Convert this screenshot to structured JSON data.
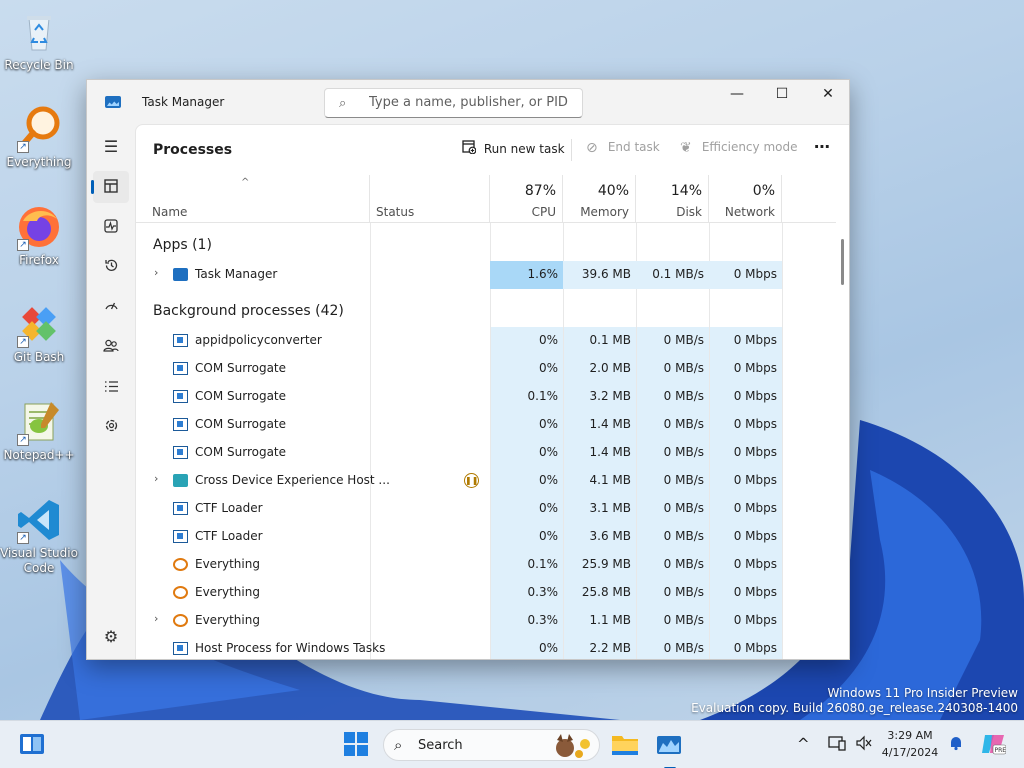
{
  "desktop": {
    "icons": [
      {
        "label": "Recycle Bin",
        "icon": "recycle-bin-icon"
      },
      {
        "label": "Everything",
        "icon": "everything-icon"
      },
      {
        "label": "Firefox",
        "icon": "firefox-icon"
      },
      {
        "label": "Git Bash",
        "icon": "git-bash-icon"
      },
      {
        "label": "Notepad++",
        "icon": "notepad-plus-plus-icon"
      },
      {
        "label": "Visual Studio Code",
        "icon": "vscode-icon"
      }
    ],
    "watermark_line1": "Windows 11 Pro Insider Preview",
    "watermark_line2": "Evaluation copy. Build 26080.ge_release.240308-1400"
  },
  "window": {
    "title": "Task Manager",
    "search_placeholder": "Type a name, publisher, or PID...",
    "controls": {
      "minimize": "—",
      "maximize": "☐",
      "close": "✕"
    }
  },
  "nav": {
    "items": [
      "menu-icon",
      "processes-icon",
      "performance-icon",
      "app-history-icon",
      "startup-apps-icon",
      "users-icon",
      "details-icon",
      "services-icon"
    ],
    "settings": "settings-icon",
    "active": "processes-icon"
  },
  "toolbar": {
    "page_title": "Processes",
    "run_new_task": "Run new task",
    "end_task": "End task",
    "efficiency_mode": "Efficiency mode",
    "more": "⋯"
  },
  "columns": {
    "name": "Name",
    "status": "Status",
    "cpu": {
      "pct": "87%",
      "label": "CPU"
    },
    "memory": {
      "pct": "40%",
      "label": "Memory"
    },
    "disk": {
      "pct": "14%",
      "label": "Disk"
    },
    "network": {
      "pct": "0%",
      "label": "Network"
    }
  },
  "groups": {
    "apps": "Apps (1)",
    "background": "Background processes (42)"
  },
  "apps": [
    {
      "name": "Task Manager",
      "icon": "task-manager-icon",
      "expandable": true,
      "cpu": "1.6%",
      "memory": "39.6 MB",
      "disk": "0.1 MB/s",
      "network": "0 Mbps"
    }
  ],
  "processes": [
    {
      "name": "appidpolicyconverter",
      "icon": "window-icon",
      "expandable": false,
      "status": "",
      "cpu": "0%",
      "memory": "0.1 MB",
      "disk": "0 MB/s",
      "network": "0 Mbps"
    },
    {
      "name": "COM Surrogate",
      "icon": "window-icon",
      "expandable": false,
      "status": "",
      "cpu": "0%",
      "memory": "2.0 MB",
      "disk": "0 MB/s",
      "network": "0 Mbps"
    },
    {
      "name": "COM Surrogate",
      "icon": "window-icon",
      "expandable": false,
      "status": "",
      "cpu": "0.1%",
      "memory": "3.2 MB",
      "disk": "0 MB/s",
      "network": "0 Mbps"
    },
    {
      "name": "COM Surrogate",
      "icon": "window-icon",
      "expandable": false,
      "status": "",
      "cpu": "0%",
      "memory": "1.4 MB",
      "disk": "0 MB/s",
      "network": "0 Mbps"
    },
    {
      "name": "COM Surrogate",
      "icon": "window-icon",
      "expandable": false,
      "status": "",
      "cpu": "0%",
      "memory": "1.4 MB",
      "disk": "0 MB/s",
      "network": "0 Mbps"
    },
    {
      "name": "Cross Device Experience Host ...",
      "icon": "cross-device-icon",
      "expandable": true,
      "status": "suspended",
      "cpu": "0%",
      "memory": "4.1 MB",
      "disk": "0 MB/s",
      "network": "0 Mbps"
    },
    {
      "name": "CTF Loader",
      "icon": "window-icon",
      "expandable": false,
      "status": "",
      "cpu": "0%",
      "memory": "3.1 MB",
      "disk": "0 MB/s",
      "network": "0 Mbps"
    },
    {
      "name": "CTF Loader",
      "icon": "window-icon",
      "expandable": false,
      "status": "",
      "cpu": "0%",
      "memory": "3.6 MB",
      "disk": "0 MB/s",
      "network": "0 Mbps"
    },
    {
      "name": "Everything",
      "icon": "everything-icon",
      "expandable": false,
      "status": "",
      "cpu": "0.1%",
      "memory": "25.9 MB",
      "disk": "0 MB/s",
      "network": "0 Mbps"
    },
    {
      "name": "Everything",
      "icon": "everything-icon",
      "expandable": false,
      "status": "",
      "cpu": "0.3%",
      "memory": "25.8 MB",
      "disk": "0 MB/s",
      "network": "0 Mbps"
    },
    {
      "name": "Everything",
      "icon": "everything-icon",
      "expandable": true,
      "status": "",
      "cpu": "0.3%",
      "memory": "1.1 MB",
      "disk": "0 MB/s",
      "network": "0 Mbps"
    },
    {
      "name": "Host Process for Windows Tasks",
      "icon": "window-icon",
      "expandable": false,
      "status": "",
      "cpu": "0%",
      "memory": "2.2 MB",
      "disk": "0 MB/s",
      "network": "0 Mbps"
    }
  ],
  "taskbar": {
    "search_label": "Search",
    "time": "3:29 AM",
    "date": "4/17/2024"
  },
  "colors": {
    "heat_light": "#dff0fb",
    "heat_strong": "#a9d8f7",
    "accent": "#005fb8"
  }
}
